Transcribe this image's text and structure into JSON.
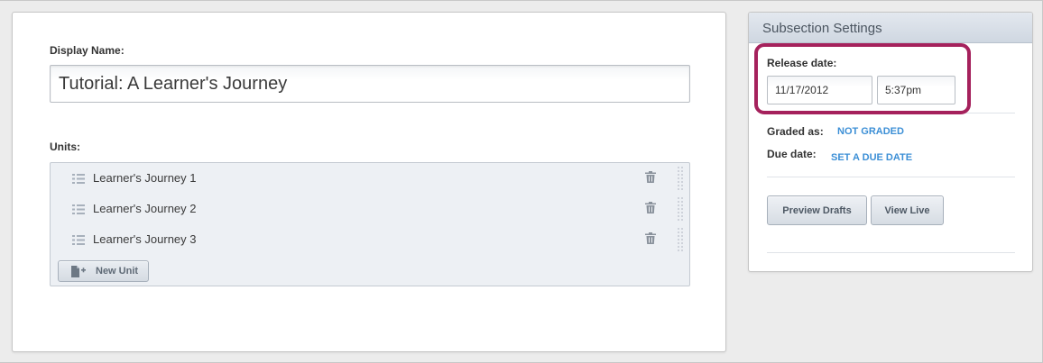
{
  "editor": {
    "display_name_label": "Display Name:",
    "display_name_value": "Tutorial: A Learner's Journey",
    "units_label": "Units:",
    "units": [
      {
        "name": "Learner's Journey 1"
      },
      {
        "name": "Learner's Journey 2"
      },
      {
        "name": "Learner's Journey 3"
      }
    ],
    "new_unit_label": "New Unit"
  },
  "settings": {
    "title": "Subsection Settings",
    "release_date_label": "Release date:",
    "release_date_value": "11/17/2012",
    "release_time_value": "5:37pm",
    "graded_as_label": "Graded as:",
    "graded_as_value": "NOT GRADED",
    "due_date_label": "Due date:",
    "due_date_link": "SET A DUE DATE",
    "preview_drafts_label": "Preview Drafts",
    "view_live_label": "View Live"
  },
  "colors": {
    "highlight": "#a5215c",
    "link": "#3c8fd6",
    "header_bg": "#d8dfe8"
  },
  "icons": {
    "unit_row": "list-icon",
    "delete": "trash-icon",
    "drag": "drag-handle-icon",
    "new_unit": "document-plus-icon"
  }
}
